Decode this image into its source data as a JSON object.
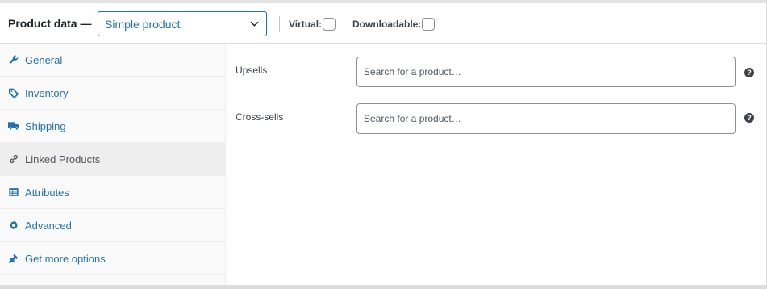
{
  "header": {
    "title": "Product data —",
    "product_type": "Simple product",
    "virtual_label": "Virtual:",
    "downloadable_label": "Downloadable:"
  },
  "sidebar": {
    "items": [
      {
        "label": "General",
        "icon": "wrench-icon"
      },
      {
        "label": "Inventory",
        "icon": "tag-icon"
      },
      {
        "label": "Shipping",
        "icon": "truck-icon"
      },
      {
        "label": "Linked Products",
        "icon": "link-icon",
        "active": true
      },
      {
        "label": "Attributes",
        "icon": "list-icon"
      },
      {
        "label": "Advanced",
        "icon": "gear-icon"
      },
      {
        "label": "Get more options",
        "icon": "plugin-icon"
      }
    ]
  },
  "main": {
    "upsells_label": "Upsells",
    "upsells_placeholder": "Search for a product…",
    "crosssells_label": "Cross-sells",
    "crosssells_placeholder": "Search for a product…",
    "help_glyph": "?"
  },
  "colors": {
    "accent": "#2271b1",
    "text": "#1d2327"
  }
}
